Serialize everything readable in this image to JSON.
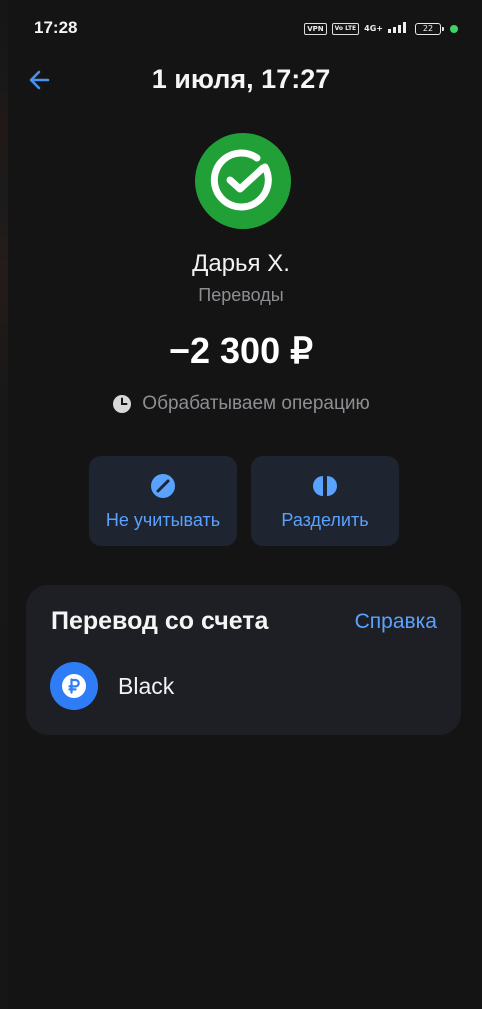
{
  "status_bar": {
    "time": "17:28",
    "vpn": "VPN",
    "volte": "Vo LTE",
    "network": "4G+",
    "battery": "22"
  },
  "header": {
    "title": "1 июля, 17:27"
  },
  "transaction": {
    "logo_icon": "sber-logo-icon",
    "name": "Дарья Х.",
    "category": "Переводы",
    "amount": "−2 300 ₽",
    "status": "Обрабатываем операцию"
  },
  "actions": [
    {
      "label": "Не учитывать",
      "icon": "not-counted-icon"
    },
    {
      "label": "Разделить",
      "icon": "split-icon"
    }
  ],
  "transfer_card": {
    "title": "Перевод со счета",
    "help_link": "Справка",
    "account_name": "Black",
    "account_icon": "ruble-icon"
  },
  "colors": {
    "background": "#141414",
    "card": "#1e1f25",
    "accent": "#5aa2ff",
    "sber_green": "#21a038"
  }
}
